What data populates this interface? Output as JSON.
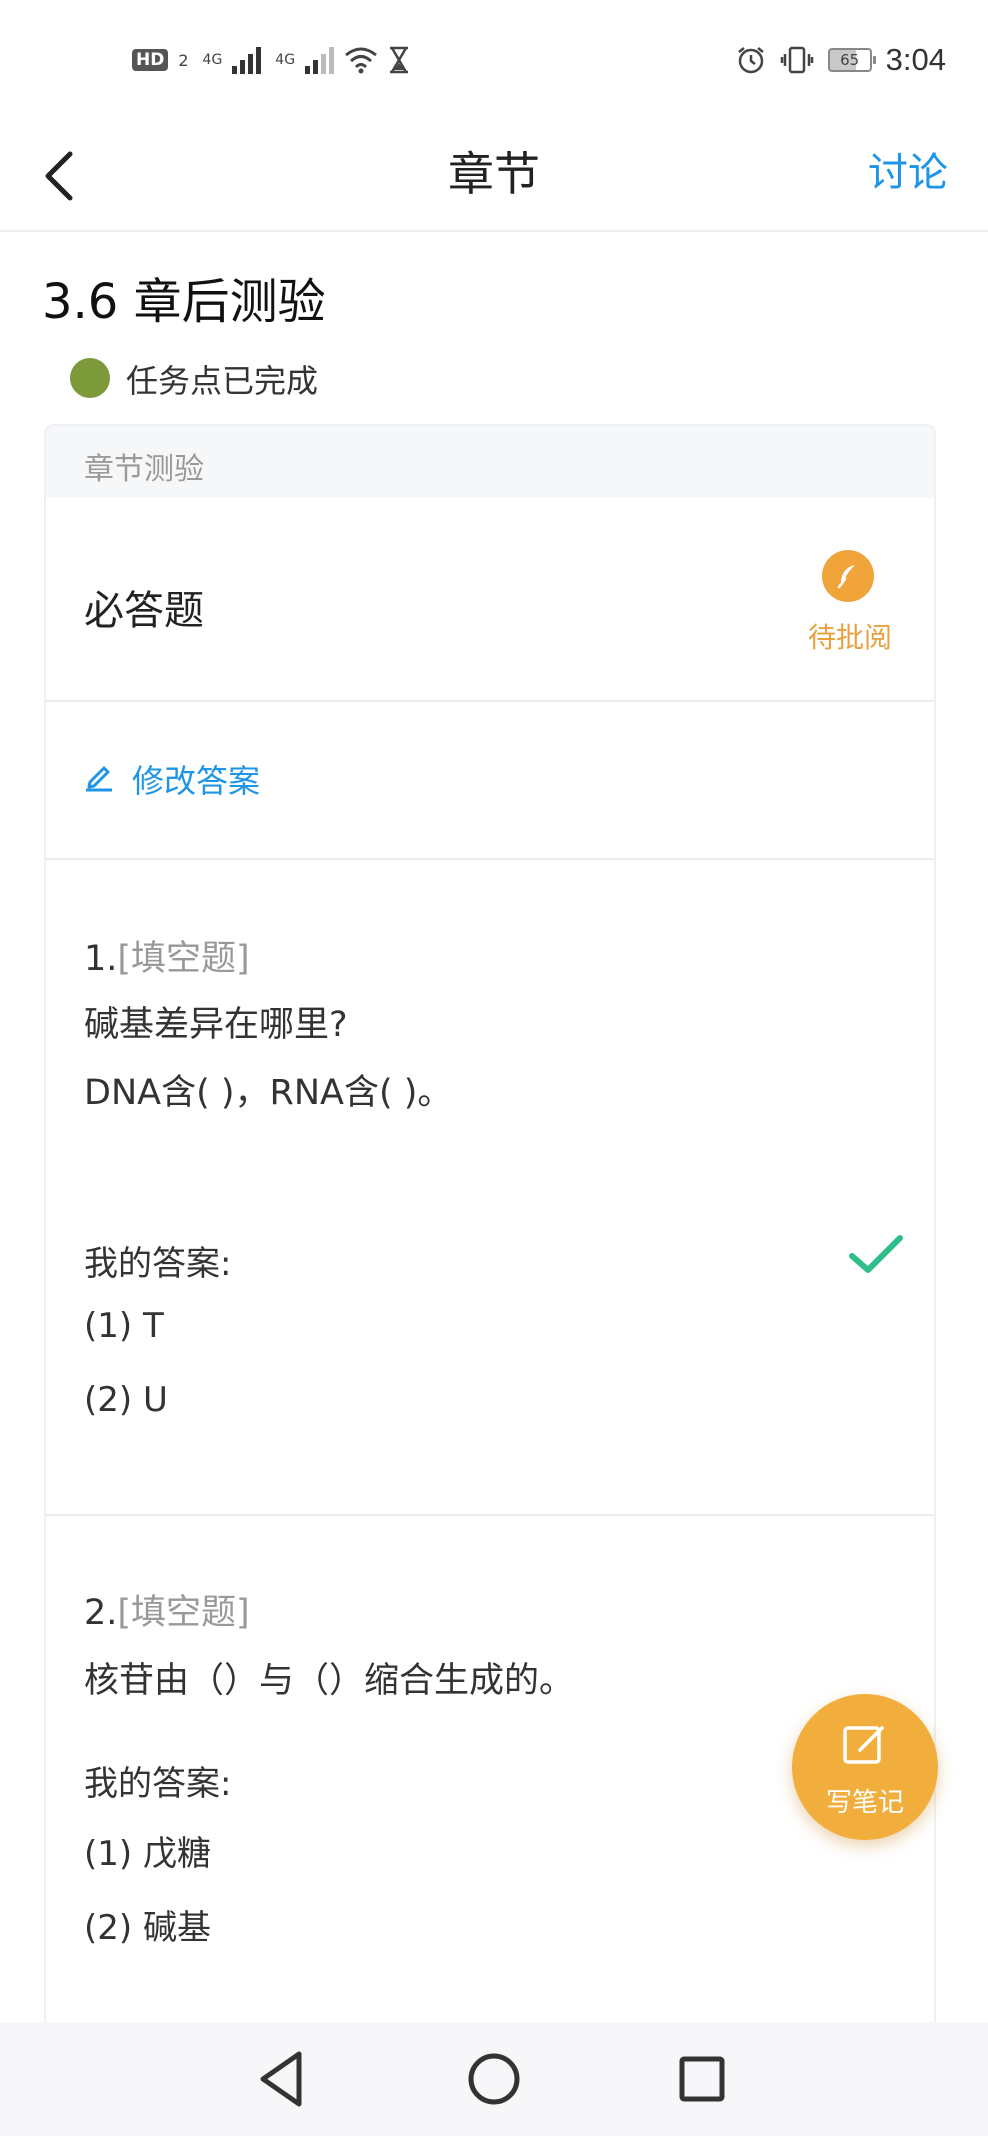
{
  "status_bar": {
    "hd": "HD",
    "hd_sub": "2",
    "net1": "4G",
    "net2": "4G",
    "battery": "65",
    "time": "3:04"
  },
  "nav": {
    "title": "章节",
    "discuss": "讨论"
  },
  "chapter": {
    "title": "3.6 章后测验",
    "task_status": "任务点已完成"
  },
  "card": {
    "header": "章节测验",
    "required_label": "必答题",
    "pending_label": "待批阅",
    "edit_label": "修改答案"
  },
  "questions": [
    {
      "number": "1.",
      "type": "[填空题]",
      "lines": [
        "碱基差异在哪里?",
        "DNA含(  )，RNA含( )。"
      ],
      "answer_label": "我的答案:",
      "answers": [
        "(1) T",
        "(2) U"
      ]
    },
    {
      "number": "2.",
      "type": "[填空题]",
      "lines": [
        "核苷由（）与（）缩合生成的。"
      ],
      "answer_label": "我的答案:",
      "answers": [
        "(1) 戊糖",
        "(2) 碱基"
      ]
    }
  ],
  "fab": {
    "label": "写笔记"
  },
  "colors": {
    "accent": "#1f95e6",
    "orange": "#f2ae3c",
    "done_green": "#7c9a3a",
    "check": "#2fbf8a"
  }
}
